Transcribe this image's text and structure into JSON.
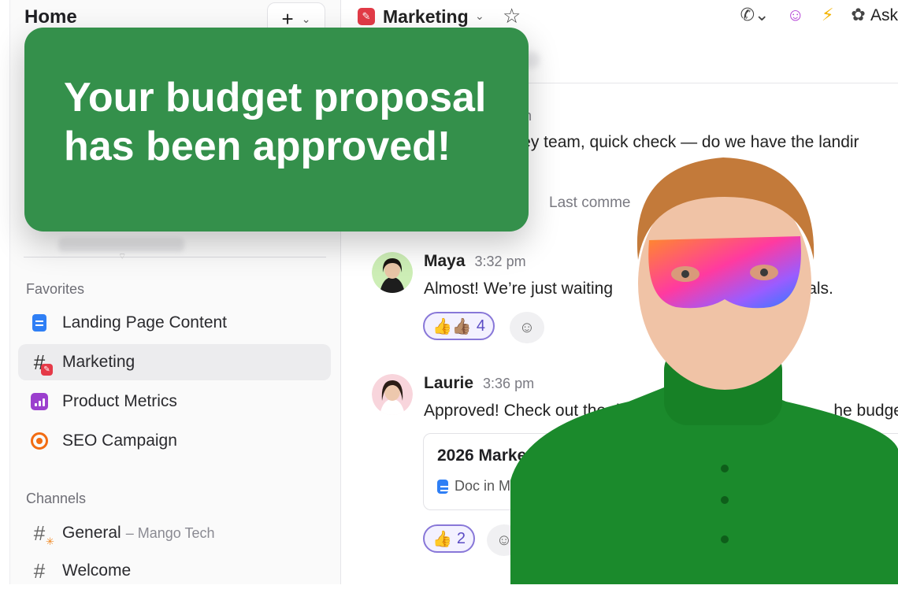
{
  "sidebar": {
    "title": "Home",
    "add_label": "+",
    "favorites_label": "Favorites",
    "favorites": [
      {
        "label": "Landing Page Content",
        "icon": "doc-icon"
      },
      {
        "label": "Marketing",
        "icon": "channel-hash-icon",
        "active": true
      },
      {
        "label": "Product Metrics",
        "icon": "chart-icon"
      },
      {
        "label": "SEO Campaign",
        "icon": "target-icon"
      }
    ],
    "channels_label": "Channels",
    "channels": [
      {
        "label": "General",
        "sub": "– Mango Tech"
      },
      {
        "label": "Welcome",
        "sub": ""
      }
    ]
  },
  "header": {
    "channel": "Marketing",
    "ask_label": "Ask"
  },
  "messages": [
    {
      "name": "",
      "time": "pm",
      "text": "Hey team, quick check — do we have the landir",
      "footer": "Last comme"
    },
    {
      "name": "Maya",
      "time": "3:32 pm",
      "text": "Almost! We’re just waiting",
      "text_end": "ovals.",
      "reaction_count": "4"
    },
    {
      "name": "Laurie",
      "time": "3:36 pm",
      "text": "Approved! Check out the do",
      "text_end": "he budget.",
      "reaction_count": "2"
    }
  ],
  "attachment": {
    "title": "2026 Market",
    "subtitle": "Doc in M"
  },
  "toast": {
    "message": "Your budget proposal has been approved!"
  },
  "colors": {
    "toast": "#34904b",
    "accent": "#8877d8",
    "channel": "#e23b47"
  }
}
